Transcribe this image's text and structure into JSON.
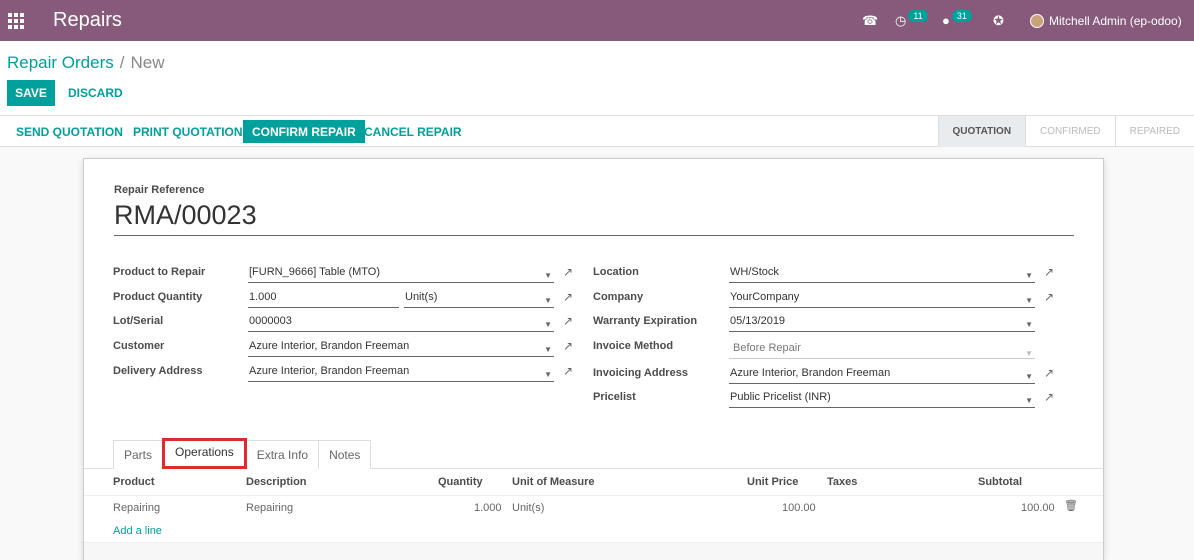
{
  "navbar": {
    "app_title": "Repairs",
    "activity_count": "11",
    "chat_count": "31",
    "user_name": "Mitchell Admin (ep-odoo)",
    "icons": [
      "apps-grid-icon",
      "phone-icon",
      "activity-clock-icon",
      "chat-icon",
      "bug-icon",
      "avatar"
    ]
  },
  "breadcrumb": {
    "parent": "Repair Orders",
    "separator": "/",
    "current": "New"
  },
  "buttons": {
    "save": "SAVE",
    "discard": "DISCARD"
  },
  "statusbar": {
    "send_quotation": "SEND QUOTATION",
    "print_quotation": "PRINT QUOTATION",
    "confirm_repair": "CONFIRM REPAIR",
    "cancel_repair": "CANCEL REPAIR",
    "stages": [
      "QUOTATION",
      "CONFIRMED",
      "REPAIRED"
    ],
    "active_stage": "QUOTATION"
  },
  "form": {
    "ref_label": "Repair Reference",
    "ref_value": "RMA/00023",
    "left": {
      "product_label": "Product to Repair",
      "product_value": "[FURN_9666] Table (MTO)",
      "qty_label": "Product Quantity",
      "qty_value": "1.000",
      "uom_value": "Unit(s)",
      "lot_label": "Lot/Serial",
      "lot_value": "0000003",
      "customer_label": "Customer",
      "customer_value": "Azure Interior, Brandon Freeman",
      "delivery_label": "Delivery Address",
      "delivery_value": "Azure Interior, Brandon Freeman"
    },
    "right": {
      "location_label": "Location",
      "location_value": "WH/Stock",
      "company_label": "Company",
      "company_value": "YourCompany",
      "warranty_label": "Warranty Expiration",
      "warranty_value": "05/13/2019",
      "invoice_method_label": "Invoice Method",
      "invoice_method_value": "Before Repair",
      "invoicing_address_label": "Invoicing Address",
      "invoicing_address_value": "Azure Interior, Brandon Freeman",
      "pricelist_label": "Pricelist",
      "pricelist_value": "Public Pricelist (INR)"
    }
  },
  "tabs": {
    "parts": "Parts",
    "operations": "Operations",
    "extra_info": "Extra Info",
    "notes": "Notes",
    "active": "Operations"
  },
  "table": {
    "headers": {
      "product": "Product",
      "description": "Description",
      "quantity": "Quantity",
      "uom": "Unit of Measure",
      "unit_price": "Unit Price",
      "taxes": "Taxes",
      "subtotal": "Subtotal"
    },
    "rows": [
      {
        "product": "Repairing",
        "description": "Repairing",
        "quantity": "1.000",
        "uom": "Unit(s)",
        "unit_price": "100.00",
        "taxes": "",
        "subtotal": "100.00"
      }
    ],
    "add_line": "Add a line"
  },
  "colors": {
    "navbar": "#875a7b",
    "accent": "#00a09d",
    "highlight": "#e02b2b"
  }
}
